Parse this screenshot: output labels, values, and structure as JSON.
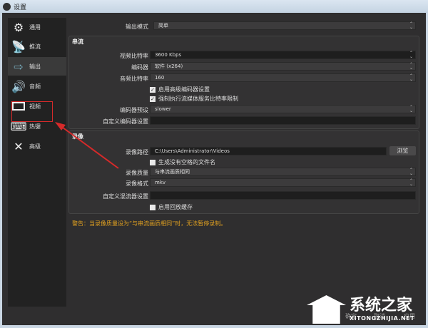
{
  "window": {
    "title": "设置"
  },
  "sidebar": {
    "items": [
      {
        "label": "通用",
        "icon": "gear-icon"
      },
      {
        "label": "推流",
        "icon": "broadcast-icon"
      },
      {
        "label": "输出",
        "icon": "output-icon"
      },
      {
        "label": "音频",
        "icon": "speaker-icon"
      },
      {
        "label": "视频",
        "icon": "monitor-icon"
      },
      {
        "label": "热键",
        "icon": "keyboard-icon"
      },
      {
        "label": "高级",
        "icon": "tools-icon"
      }
    ],
    "selected": "输出"
  },
  "output_mode": {
    "label": "输出模式",
    "value": "简单"
  },
  "stream": {
    "title": "串流",
    "video_bitrate": {
      "label": "视频比特率",
      "value": "3600 Kbps"
    },
    "encoder": {
      "label": "编码器",
      "value": "软件 (x264)"
    },
    "audio_bitrate": {
      "label": "音频比特率",
      "value": "160"
    },
    "adv_encoder": {
      "label": "启用高级编码器设置",
      "checked": true
    },
    "enforce_limits": {
      "label": "强制执行流媒体服务比特率限制",
      "checked": true
    },
    "preset": {
      "label": "编码器预设",
      "value": "slower"
    },
    "custom_settings": {
      "label": "自定义编码器设置",
      "value": ""
    }
  },
  "recording": {
    "title": "录像",
    "path": {
      "label": "录像路径",
      "value": "C:\\Users\\Administrator\\Videos"
    },
    "browse": "浏览",
    "no_space": {
      "label": "生成没有空格的文件名",
      "checked": false
    },
    "quality": {
      "label": "录像质量",
      "value": "与串流画质相同"
    },
    "format": {
      "label": "录像格式",
      "value": "mkv"
    },
    "muxer": {
      "label": "自定义混流器设置",
      "value": ""
    },
    "replay": {
      "label": "启用回放缓存",
      "checked": false
    }
  },
  "warning": "警告：当录像质量设为“与串流画质相同”时，无法暂停录制。",
  "buttons": {
    "ok": "确定",
    "cancel": "取消",
    "apply": "应用"
  },
  "watermark": {
    "cn": "系统之家",
    "en": "XITONGZHIJIA.NET"
  },
  "colors": {
    "warning": "#e0a020",
    "highlight": "#d62a2a"
  }
}
